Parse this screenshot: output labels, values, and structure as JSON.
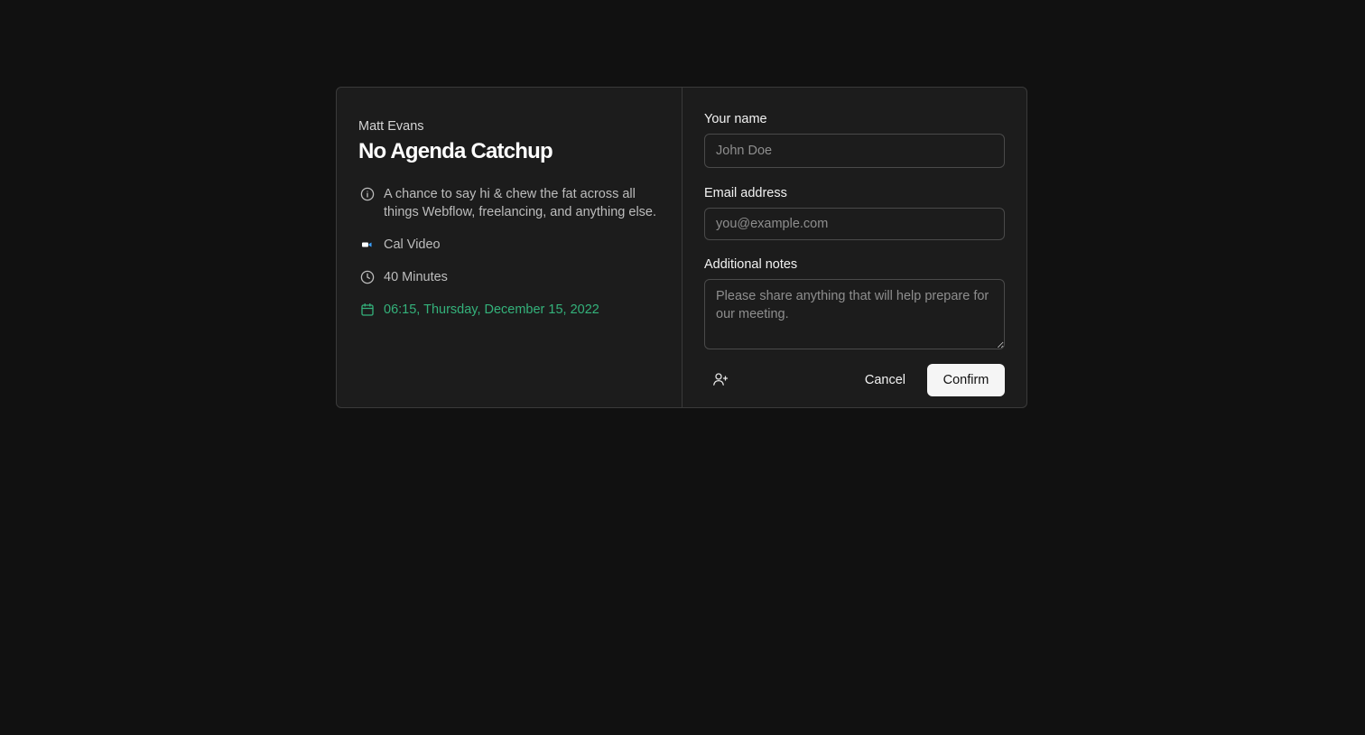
{
  "event": {
    "organizer": "Matt Evans",
    "title": "No Agenda Catchup",
    "description": "A chance to say hi & chew the fat across all things Webflow, freelancing, and anything else.",
    "location": "Cal Video",
    "duration": "40 Minutes",
    "datetime": "06:15, Thursday, December 15, 2022"
  },
  "form": {
    "name_label": "Your name",
    "name_placeholder": "John Doe",
    "name_value": "",
    "email_label": "Email address",
    "email_placeholder": "you@example.com",
    "email_value": "",
    "notes_label": "Additional notes",
    "notes_placeholder": "Please share anything that will help prepare for our meeting.",
    "notes_value": ""
  },
  "actions": {
    "add_guest_icon": "user-plus-icon",
    "cancel_label": "Cancel",
    "confirm_label": "Confirm"
  },
  "colors": {
    "background": "#111111",
    "card": "#1c1c1c",
    "accent_date": "#34b27b",
    "confirm_bg": "#f5f5f5"
  },
  "icons": {
    "description": "info-icon",
    "location": "cal-video-icon",
    "duration": "clock-icon",
    "datetime": "calendar-icon"
  }
}
